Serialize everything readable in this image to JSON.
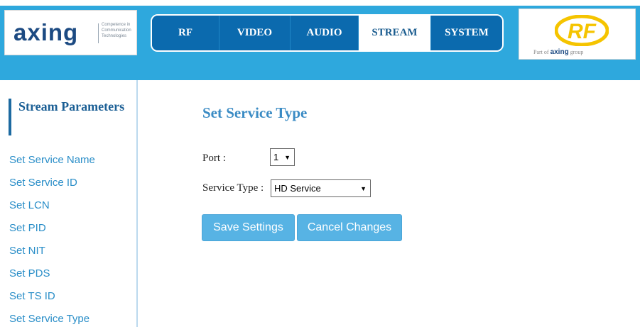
{
  "header": {
    "logo": {
      "name": "axing",
      "tagline": "Competence in Communication Technologies"
    },
    "partner_logo": {
      "mark": "RF",
      "caption_prefix": "Part of",
      "caption_brand": "axing",
      "caption_suffix": "group"
    },
    "nav": [
      {
        "label": "RF",
        "active": false
      },
      {
        "label": "VIDEO",
        "active": false
      },
      {
        "label": "AUDIO",
        "active": false
      },
      {
        "label": "STREAM",
        "active": true
      },
      {
        "label": "SYSTEM",
        "active": false
      }
    ]
  },
  "sidebar": {
    "title": "Stream Parameters",
    "items": [
      {
        "label": "Set Service Name"
      },
      {
        "label": "Set Service ID"
      },
      {
        "label": "Set LCN"
      },
      {
        "label": "Set PID"
      },
      {
        "label": "Set NIT"
      },
      {
        "label": "Set PDS"
      },
      {
        "label": "Set TS ID"
      },
      {
        "label": "Set Service Type"
      }
    ]
  },
  "main": {
    "title": "Set Service Type",
    "port": {
      "label": "Port :",
      "value": "1"
    },
    "service_type": {
      "label": "Service Type :",
      "value": "HD Service"
    },
    "buttons": {
      "save": "Save Settings",
      "cancel": "Cancel Changes"
    }
  },
  "colors": {
    "header_bg": "#2ea8dd",
    "nav_bg": "#0b6aae",
    "nav_active_bg": "#ffffff",
    "sidebar_link": "#2a8ec8",
    "title_blue": "#3a8bc4",
    "button_bg": "#57b3e4",
    "axing_text": "#1c4a82",
    "rf_logo_yellow": "#f5c400"
  },
  "icons": {
    "dropdown": "chevron-down-icon"
  }
}
